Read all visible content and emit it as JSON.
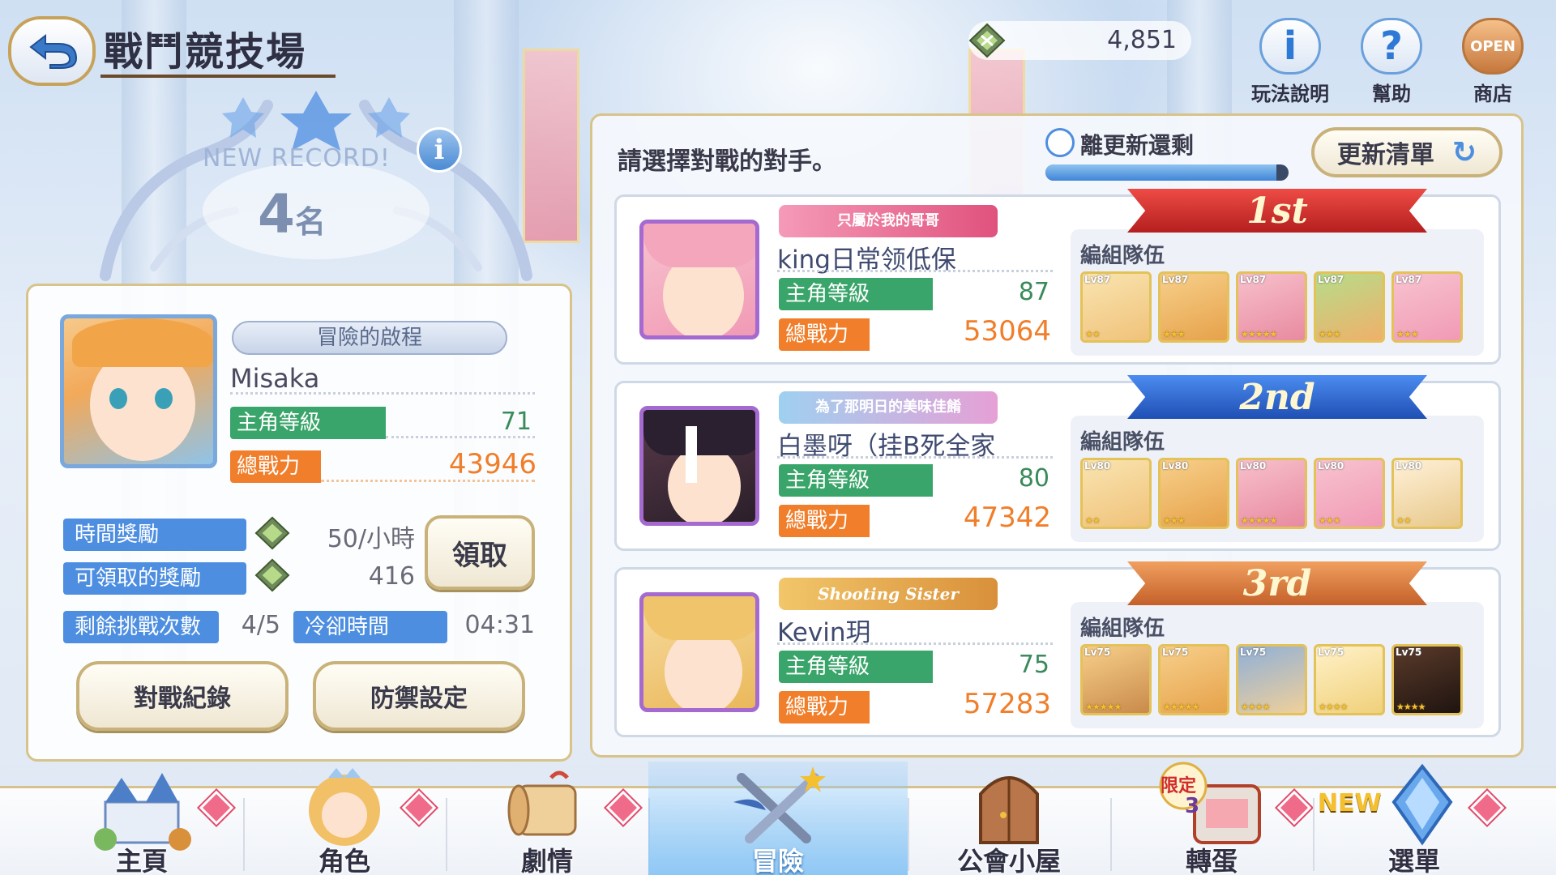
{
  "header": {
    "title": "戰鬥競技場",
    "currency_value": "4,851",
    "help_rules_label": "玩法說明",
    "help_label": "幫助",
    "shop_label": "商店",
    "shop_badge": "OPEN"
  },
  "record": {
    "new_record": "NEW RECORD!",
    "rank_number": "4",
    "rank_suffix": "名"
  },
  "player": {
    "title_badge": "冒險的啟程",
    "name": "Misaka",
    "level_label": "主角等級",
    "level": "71",
    "power_label": "總戰力",
    "power": "43946"
  },
  "rewards": {
    "time_reward_label": "時間獎勵",
    "time_reward_value": "50/小時",
    "claimable_label": "可領取的獎勵",
    "claimable_value": "416",
    "claim_button": "領取",
    "remaining_label": "剩餘挑戰次數",
    "remaining_value": "4/5",
    "cooldown_label": "冷卻時間",
    "cooldown_value": "04:31"
  },
  "actions": {
    "battle_log": "對戰紀錄",
    "defense_settings": "防禦設定"
  },
  "opponents_panel": {
    "instruction": "請選擇對戰的對手。",
    "refresh_timer_label": "離更新還剩",
    "refresh_progress": 0.95,
    "refresh_button": "更新清單"
  },
  "opponents": [
    {
      "rank_badge": "1st",
      "title": "只屬於我的哥哥",
      "name": "king日常领低保",
      "level_label": "主角等級",
      "level": "87",
      "power_label": "總戰力",
      "power": "53064",
      "team_label": "編組隊伍",
      "team": [
        {
          "lv": "Lv87",
          "stars": "★★"
        },
        {
          "lv": "Lv87",
          "stars": "★★★"
        },
        {
          "lv": "Lv87",
          "stars": "★★★★★"
        },
        {
          "lv": "Lv87",
          "stars": "★★★"
        },
        {
          "lv": "Lv87",
          "stars": "★★★"
        }
      ]
    },
    {
      "rank_badge": "2nd",
      "title": "為了那明日的美味佳餚",
      "name": "白墨呀（挂B死全家",
      "level_label": "主角等級",
      "level": "80",
      "power_label": "總戰力",
      "power": "47342",
      "team_label": "編組隊伍",
      "team": [
        {
          "lv": "Lv80",
          "stars": "★★"
        },
        {
          "lv": "Lv80",
          "stars": "★★★"
        },
        {
          "lv": "Lv80",
          "stars": "★★★★★"
        },
        {
          "lv": "Lv80",
          "stars": "★★★"
        },
        {
          "lv": "Lv80",
          "stars": "★★"
        }
      ]
    },
    {
      "rank_badge": "3rd",
      "title": "Shooting Sister",
      "name": "Kevin玥",
      "level_label": "主角等級",
      "level": "75",
      "power_label": "總戰力",
      "power": "57283",
      "team_label": "編組隊伍",
      "team": [
        {
          "lv": "Lv75",
          "stars": "★★★★★"
        },
        {
          "lv": "Lv75",
          "stars": "★★★★★"
        },
        {
          "lv": "Lv75",
          "stars": "★★★★"
        },
        {
          "lv": "Lv75",
          "stars": "★★★★"
        },
        {
          "lv": "Lv75",
          "stars": "★★★★"
        }
      ]
    }
  ],
  "nav": {
    "home": "主頁",
    "characters": "角色",
    "story": "劇情",
    "adventure": "冒險",
    "guild": "公會小屋",
    "gacha": "轉蛋",
    "menu": "選單",
    "gacha_badge_text": "限定",
    "gacha_badge_num": "3",
    "menu_badge": "NEW"
  },
  "colors": {
    "accent_blue": "#4d8ee0",
    "level_green": "#3aa56a",
    "power_orange": "#f07e2a",
    "gold_border": "#c9b27a",
    "rank1_red": "#d8322e",
    "rank2_blue": "#2e66d0",
    "rank3_orange": "#e07a34"
  }
}
